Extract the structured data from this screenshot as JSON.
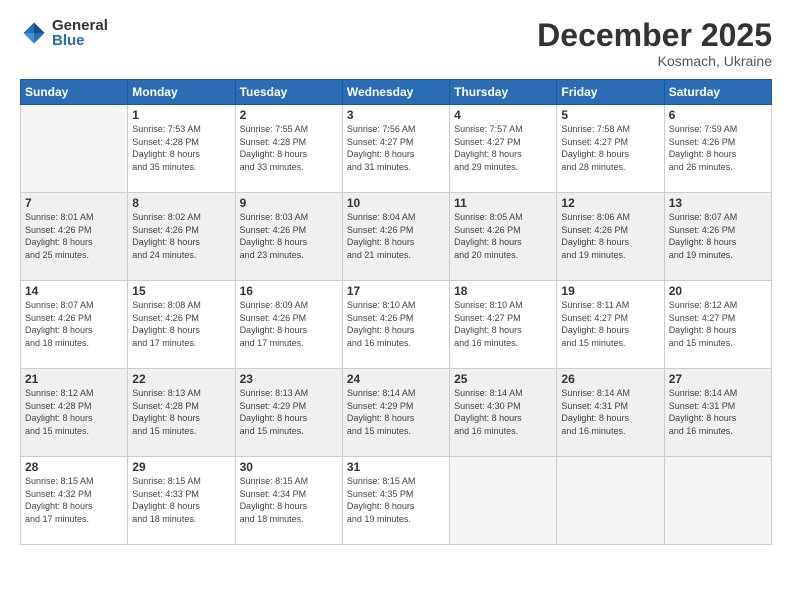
{
  "logo": {
    "general": "General",
    "blue": "Blue"
  },
  "title": "December 2025",
  "subtitle": "Kosmach, Ukraine",
  "header_days": [
    "Sunday",
    "Monday",
    "Tuesday",
    "Wednesday",
    "Thursday",
    "Friday",
    "Saturday"
  ],
  "weeks": [
    [
      {
        "day": "",
        "info": ""
      },
      {
        "day": "1",
        "info": "Sunrise: 7:53 AM\nSunset: 4:28 PM\nDaylight: 8 hours\nand 35 minutes."
      },
      {
        "day": "2",
        "info": "Sunrise: 7:55 AM\nSunset: 4:28 PM\nDaylight: 8 hours\nand 33 minutes."
      },
      {
        "day": "3",
        "info": "Sunrise: 7:56 AM\nSunset: 4:27 PM\nDaylight: 8 hours\nand 31 minutes."
      },
      {
        "day": "4",
        "info": "Sunrise: 7:57 AM\nSunset: 4:27 PM\nDaylight: 8 hours\nand 29 minutes."
      },
      {
        "day": "5",
        "info": "Sunrise: 7:58 AM\nSunset: 4:27 PM\nDaylight: 8 hours\nand 28 minutes."
      },
      {
        "day": "6",
        "info": "Sunrise: 7:59 AM\nSunset: 4:26 PM\nDaylight: 8 hours\nand 26 minutes."
      }
    ],
    [
      {
        "day": "7",
        "info": "Sunrise: 8:01 AM\nSunset: 4:26 PM\nDaylight: 8 hours\nand 25 minutes."
      },
      {
        "day": "8",
        "info": "Sunrise: 8:02 AM\nSunset: 4:26 PM\nDaylight: 8 hours\nand 24 minutes."
      },
      {
        "day": "9",
        "info": "Sunrise: 8:03 AM\nSunset: 4:26 PM\nDaylight: 8 hours\nand 23 minutes."
      },
      {
        "day": "10",
        "info": "Sunrise: 8:04 AM\nSunset: 4:26 PM\nDaylight: 8 hours\nand 21 minutes."
      },
      {
        "day": "11",
        "info": "Sunrise: 8:05 AM\nSunset: 4:26 PM\nDaylight: 8 hours\nand 20 minutes."
      },
      {
        "day": "12",
        "info": "Sunrise: 8:06 AM\nSunset: 4:26 PM\nDaylight: 8 hours\nand 19 minutes."
      },
      {
        "day": "13",
        "info": "Sunrise: 8:07 AM\nSunset: 4:26 PM\nDaylight: 8 hours\nand 19 minutes."
      }
    ],
    [
      {
        "day": "14",
        "info": "Sunrise: 8:07 AM\nSunset: 4:26 PM\nDaylight: 8 hours\nand 18 minutes."
      },
      {
        "day": "15",
        "info": "Sunrise: 8:08 AM\nSunset: 4:26 PM\nDaylight: 8 hours\nand 17 minutes."
      },
      {
        "day": "16",
        "info": "Sunrise: 8:09 AM\nSunset: 4:26 PM\nDaylight: 8 hours\nand 17 minutes."
      },
      {
        "day": "17",
        "info": "Sunrise: 8:10 AM\nSunset: 4:26 PM\nDaylight: 8 hours\nand 16 minutes."
      },
      {
        "day": "18",
        "info": "Sunrise: 8:10 AM\nSunset: 4:27 PM\nDaylight: 8 hours\nand 16 minutes."
      },
      {
        "day": "19",
        "info": "Sunrise: 8:11 AM\nSunset: 4:27 PM\nDaylight: 8 hours\nand 15 minutes."
      },
      {
        "day": "20",
        "info": "Sunrise: 8:12 AM\nSunset: 4:27 PM\nDaylight: 8 hours\nand 15 minutes."
      }
    ],
    [
      {
        "day": "21",
        "info": "Sunrise: 8:12 AM\nSunset: 4:28 PM\nDaylight: 8 hours\nand 15 minutes."
      },
      {
        "day": "22",
        "info": "Sunrise: 8:13 AM\nSunset: 4:28 PM\nDaylight: 8 hours\nand 15 minutes."
      },
      {
        "day": "23",
        "info": "Sunrise: 8:13 AM\nSunset: 4:29 PM\nDaylight: 8 hours\nand 15 minutes."
      },
      {
        "day": "24",
        "info": "Sunrise: 8:14 AM\nSunset: 4:29 PM\nDaylight: 8 hours\nand 15 minutes."
      },
      {
        "day": "25",
        "info": "Sunrise: 8:14 AM\nSunset: 4:30 PM\nDaylight: 8 hours\nand 16 minutes."
      },
      {
        "day": "26",
        "info": "Sunrise: 8:14 AM\nSunset: 4:31 PM\nDaylight: 8 hours\nand 16 minutes."
      },
      {
        "day": "27",
        "info": "Sunrise: 8:14 AM\nSunset: 4:31 PM\nDaylight: 8 hours\nand 16 minutes."
      }
    ],
    [
      {
        "day": "28",
        "info": "Sunrise: 8:15 AM\nSunset: 4:32 PM\nDaylight: 8 hours\nand 17 minutes."
      },
      {
        "day": "29",
        "info": "Sunrise: 8:15 AM\nSunset: 4:33 PM\nDaylight: 8 hours\nand 18 minutes."
      },
      {
        "day": "30",
        "info": "Sunrise: 8:15 AM\nSunset: 4:34 PM\nDaylight: 8 hours\nand 18 minutes."
      },
      {
        "day": "31",
        "info": "Sunrise: 8:15 AM\nSunset: 4:35 PM\nDaylight: 8 hours\nand 19 minutes."
      },
      {
        "day": "",
        "info": ""
      },
      {
        "day": "",
        "info": ""
      },
      {
        "day": "",
        "info": ""
      }
    ]
  ]
}
